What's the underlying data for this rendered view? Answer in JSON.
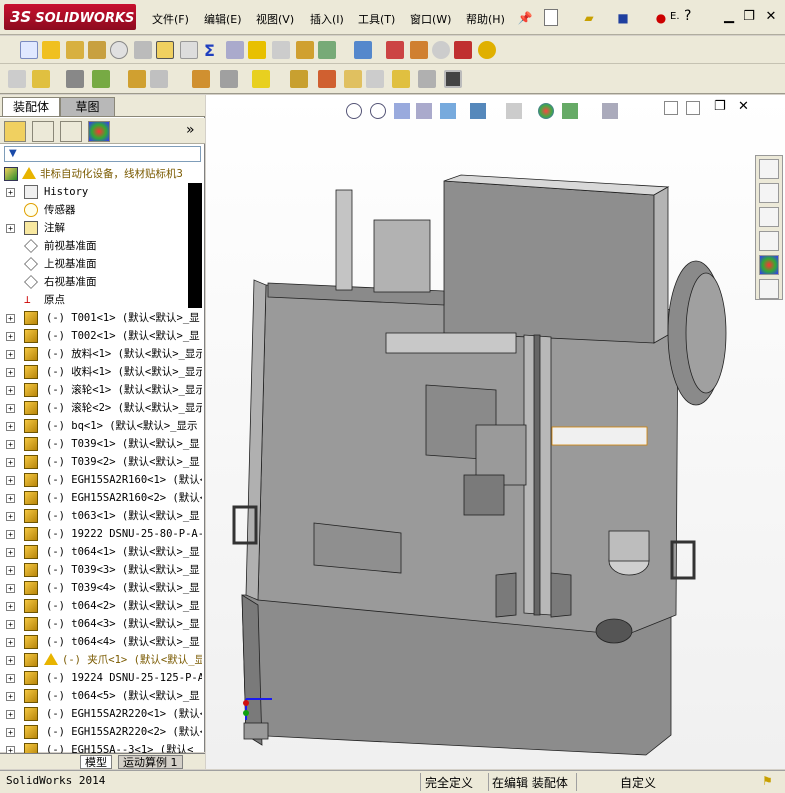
{
  "app": {
    "logo_text": "SOLIDWORKS",
    "logo_prefix": "3S"
  },
  "menu": {
    "items": [
      "文件(F)",
      "编辑(E)",
      "视图(V)",
      "插入(I)",
      "工具(T)",
      "窗口(W)",
      "帮助(H)"
    ],
    "extra_label": "E.",
    "help_icon_label": "?"
  },
  "panel_tabs": {
    "assembly": "装配体",
    "sketch": "草图"
  },
  "manager_tabs": {
    "more": "»"
  },
  "filter": {
    "icon_label": "▼"
  },
  "tree": {
    "root_label": "非标自动化设备，线材贴标机3",
    "fixed_nodes": [
      {
        "label": "History",
        "icon": "hist"
      },
      {
        "label": "传感器",
        "icon": "sensor"
      },
      {
        "label": "注解",
        "icon": "annot"
      },
      {
        "label": "前视基准面",
        "icon": "ref"
      },
      {
        "label": "上视基准面",
        "icon": "ref"
      },
      {
        "label": "右视基准面",
        "icon": "ref"
      },
      {
        "label": "原点",
        "icon": "origin"
      }
    ],
    "components": [
      "(-) T001<1> (默认<默认>_显",
      "(-) T002<1> (默认<默认>_显",
      "(-) 放料<1> (默认<默认>_显示",
      "(-) 收料<1> (默认<默认>_显示",
      "(-) 滚轮<1> (默认<默认>_显示",
      "(-) 滚轮<2> (默认<默认>_显示",
      "(-) bq<1> (默认<默认>_显示",
      "(-) T039<1> (默认<默认>_显",
      "(-) T039<2> (默认<默认>_显",
      "(-) EGH15SA2R160<1> (默认<",
      "(-) EGH15SA2R160<2> (默认<",
      "(-) t063<1> (默认<默认>_显",
      "(-) 19222 DSNU-25-80-P-A--",
      "(-) t064<1> (默认<默认>_显",
      "(-) T039<3> (默认<默认>_显",
      "(-) T039<4> (默认<默认>_显",
      "(-) t064<2> (默认<默认>_显",
      "(-) t064<3> (默认<默认>_显",
      "(-) t064<4> (默认<默认>_显",
      "(-) 夹爪<1> (默认<默认_显",
      "(-) 19224 DSNU-25-125-P-A--",
      "(-) t064<5> (默认<默认>_显",
      "(-) EGH15SA2R220<1> (默认<",
      "(-) EGH15SA2R220<2> (默认<",
      "(-) EGH15SA--3<1> (默认<"
    ],
    "warn_component_index": 19
  },
  "bottom_tabs": {
    "model": "模型",
    "motion": "运动算例 1"
  },
  "status": {
    "app_version": "SolidWorks 2014",
    "definition": "完全定义",
    "editing": "在编辑 装配体",
    "custom": "自定义"
  },
  "colors": {
    "brand_red": "#c8102e",
    "chrome": "#ece9d8",
    "model_gray": "#8c8c8c"
  }
}
